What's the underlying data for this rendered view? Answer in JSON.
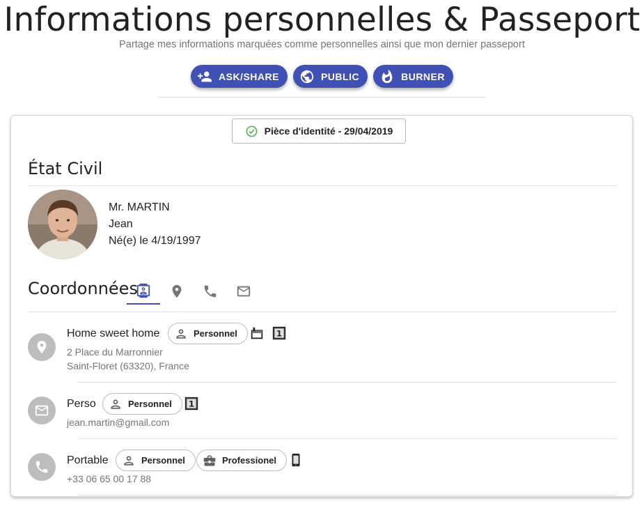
{
  "header": {
    "title": "Informations personnelles & Passeport",
    "subtitle": "Partage mes informations marquées comme personnelles ainsi que mon dernier passeport"
  },
  "actions": [
    {
      "label": "ASK/SHARE",
      "icon": "person-add-icon"
    },
    {
      "label": "PUBLIC",
      "icon": "globe-icon"
    },
    {
      "label": "BURNER",
      "icon": "fire-icon"
    }
  ],
  "colors": {
    "accent": "#3f51b5",
    "success": "#4caf50",
    "icon_grey": "#bdbdbd"
  },
  "id_document": {
    "label": "Pièce d'identité - 29/04/2019",
    "icon": "check-circle-icon"
  },
  "etat_civil": {
    "title": "État Civil",
    "name_line": "Mr. MARTIN",
    "first_name": "Jean",
    "birth": "Né(e) le 4/19/1997"
  },
  "coordonnees": {
    "title": "Coordonnées",
    "tabs": [
      "contacts-icon",
      "location-icon",
      "phone-icon",
      "mail-icon"
    ]
  },
  "entries": {
    "address": {
      "title": "Home sweet home",
      "tag": "Personnel",
      "line1": "2 Place du Marronnier",
      "line2": "Saint-Floret (63320), France",
      "badge": "1"
    },
    "email": {
      "title": "Perso",
      "tag": "Personnel",
      "value": "jean.martin@gmail.com",
      "badge": "1"
    },
    "phone": {
      "title": "Portable",
      "tag1": "Personnel",
      "tag2": "Professionel",
      "value": "+33  06 65 00 17 88"
    }
  }
}
